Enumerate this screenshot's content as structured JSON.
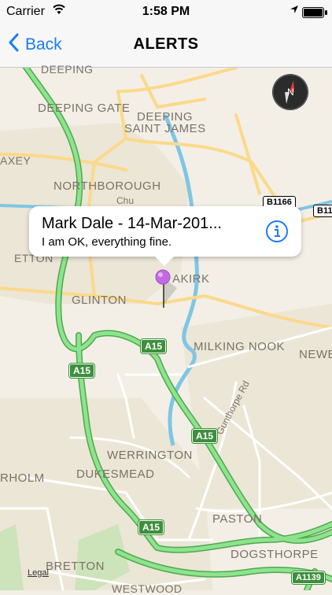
{
  "status": {
    "carrier": "Carrier",
    "time": "1:58 PM"
  },
  "nav": {
    "back_label": "Back",
    "title": "ALERTS"
  },
  "map": {
    "places": [
      {
        "name": "DEEPING"
      },
      {
        "name": "DEEPING GATE"
      },
      {
        "name": "DEEPING"
      },
      {
        "name": "SAINT JAMES"
      },
      {
        "name": "AXEY"
      },
      {
        "name": "NORTHBOROUGH"
      },
      {
        "name": "ETTON"
      },
      {
        "name": "GLINTON"
      },
      {
        "name": "AKIRK"
      },
      {
        "name": "MILKING NOOK"
      },
      {
        "name": "NEWE"
      },
      {
        "name": "WERRINGTON"
      },
      {
        "name": "DUKESMEAD"
      },
      {
        "name": "RHOLM"
      },
      {
        "name": "PASTON"
      },
      {
        "name": "DOGSTHORPE"
      },
      {
        "name": "BRETTON"
      },
      {
        "name": "WESTWOOD"
      }
    ],
    "road_labels": [
      {
        "text": "Gunthorpe Rd"
      },
      {
        "text": "Chu"
      }
    ],
    "shields": [
      {
        "text": "A15",
        "type": "green"
      },
      {
        "text": "A15",
        "type": "green"
      },
      {
        "text": "A15",
        "type": "green"
      },
      {
        "text": "A15",
        "type": "green"
      },
      {
        "text": "A1139",
        "type": "green"
      },
      {
        "text": "B1166",
        "type": "white"
      },
      {
        "text": "B11",
        "type": "white"
      }
    ],
    "compass_label": "N",
    "legal": "Legal"
  },
  "callout": {
    "title": "Mark Dale  - 14-Mar-201...",
    "subtitle": "I am OK, everything fine."
  },
  "colors": {
    "accent": "#1a7cf5",
    "land": "#f3efe6",
    "major_road": "#8fe38f",
    "minor_road": "#fbd98a",
    "water": "#7fc6e3",
    "pin": "#c36ae3"
  }
}
